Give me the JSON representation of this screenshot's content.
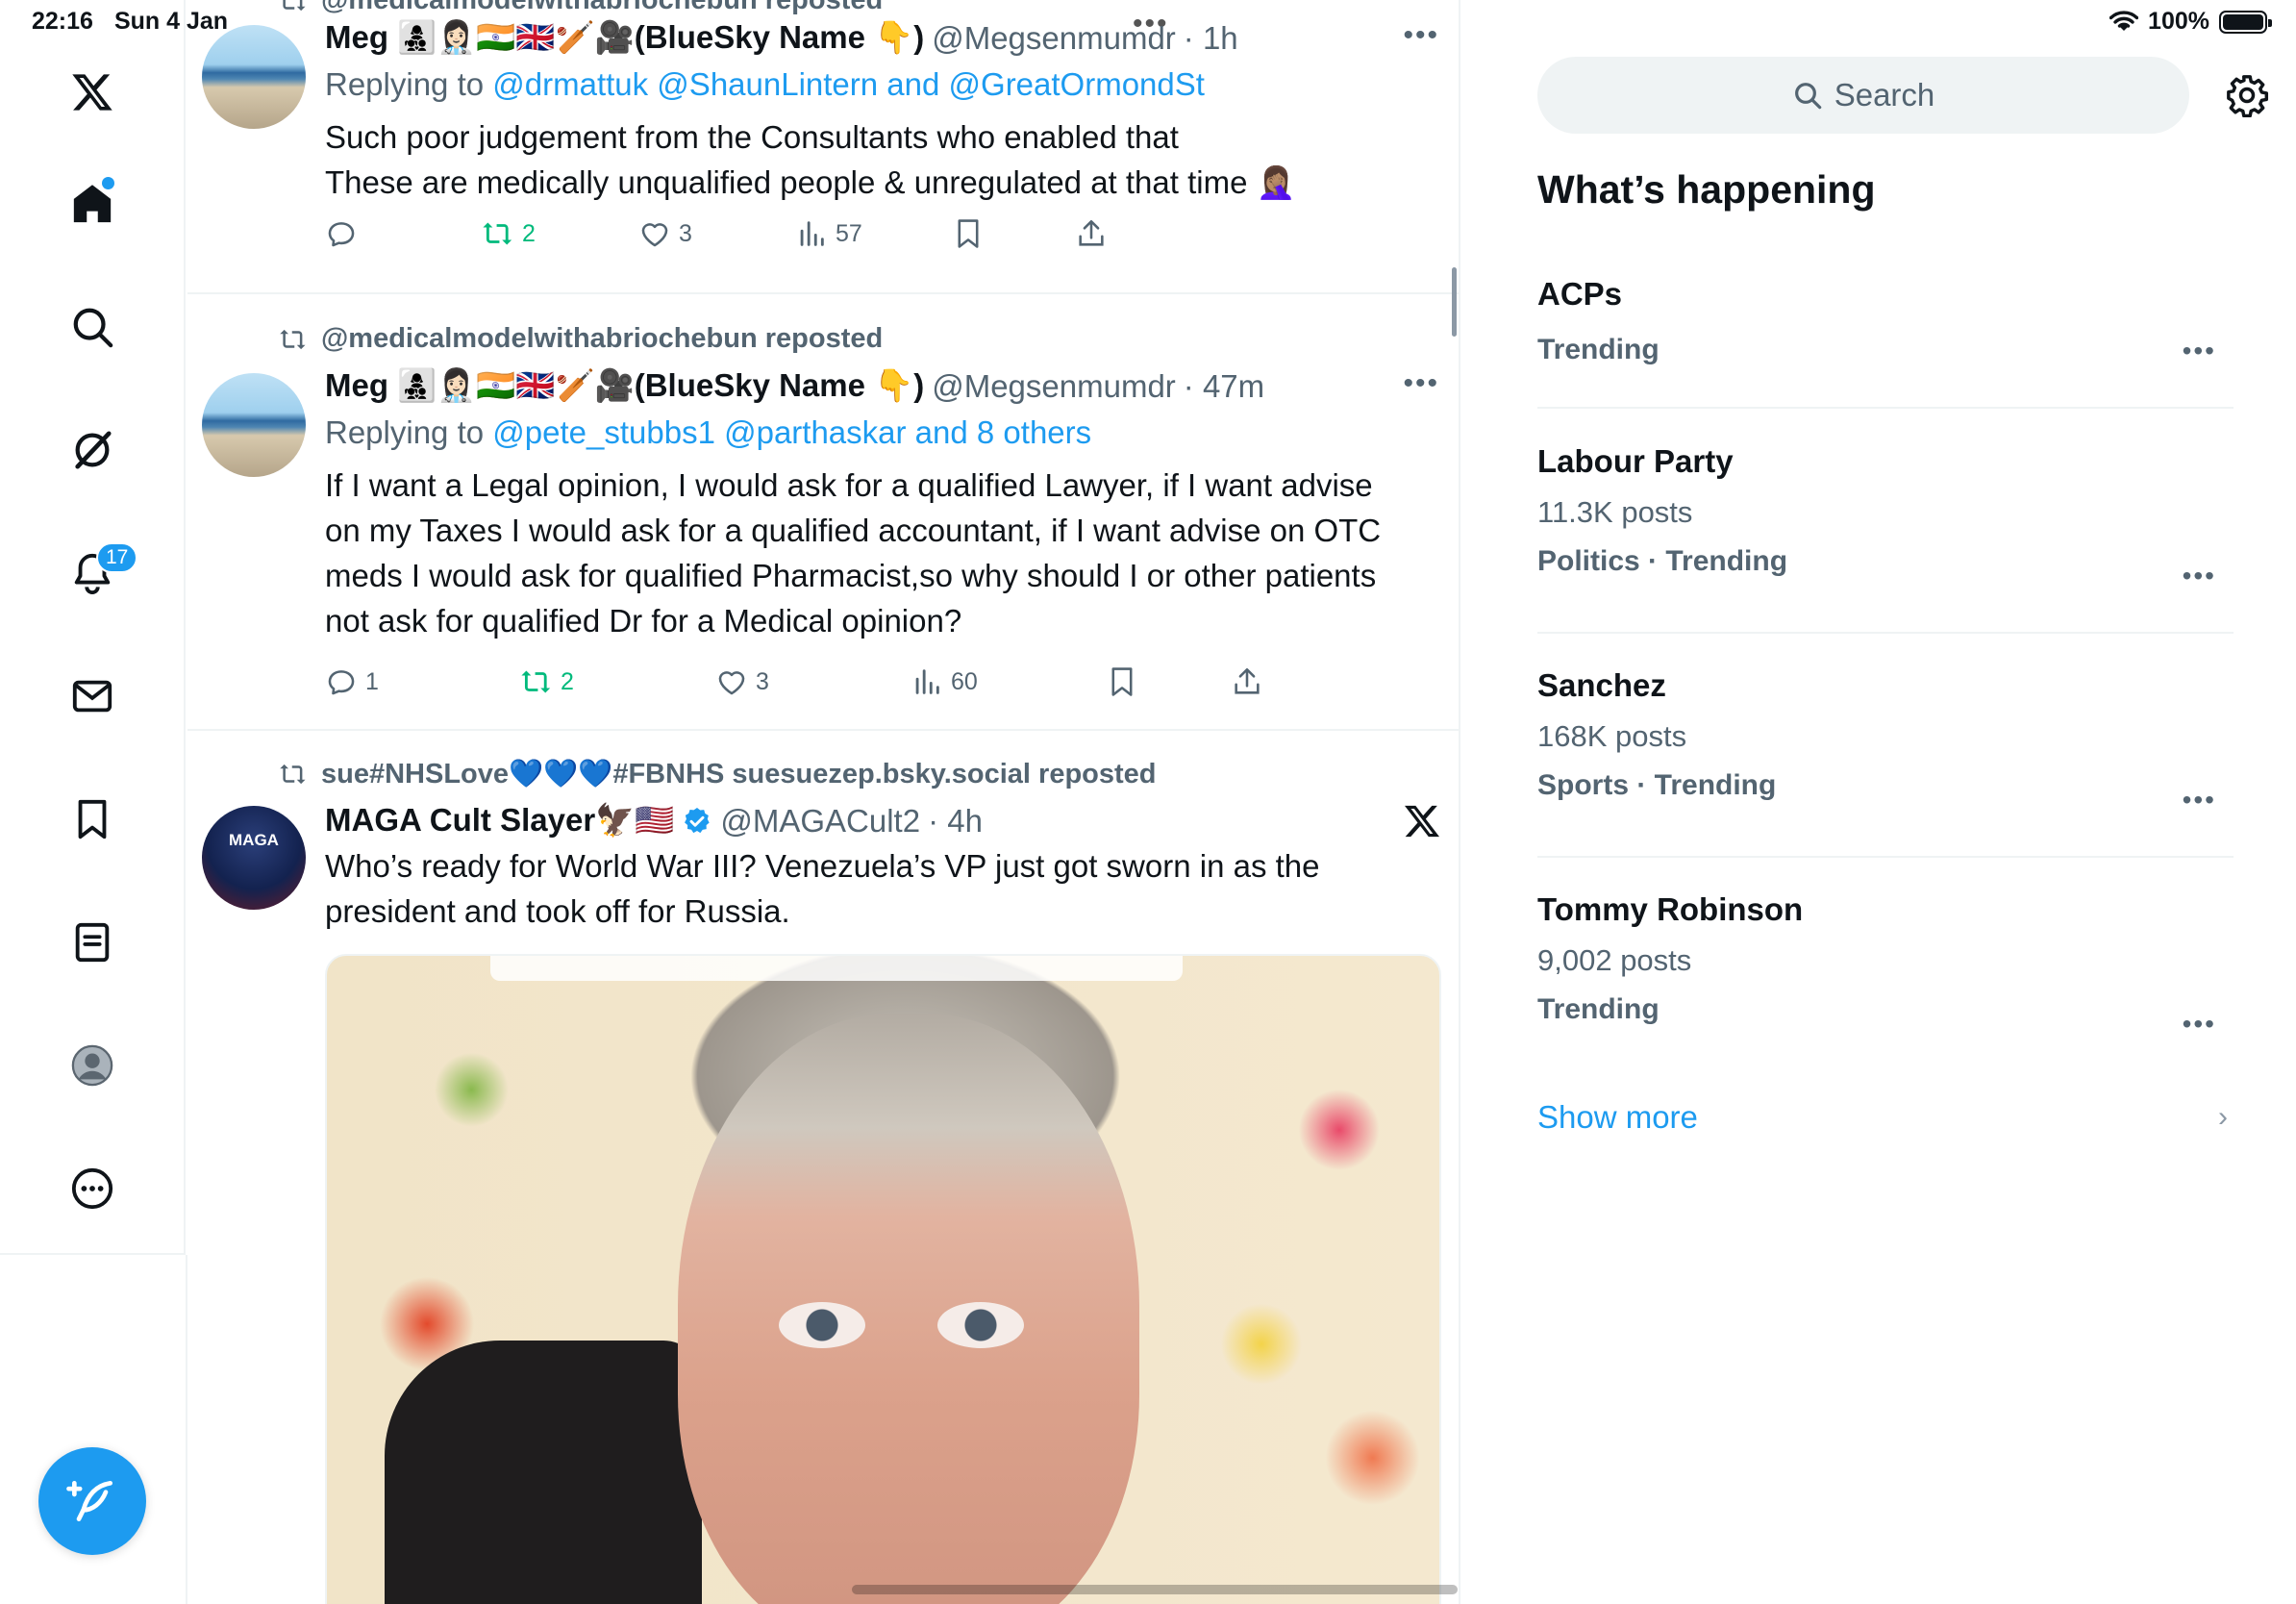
{
  "status": {
    "time": "22:16",
    "date": "Sun 4 Jan",
    "battery": "100%"
  },
  "nav": {
    "notifications_badge": "17"
  },
  "posts": [
    {
      "repost_label": "@medicalmodelwithabriochebun reposted",
      "name": "Meg 👩‍👧‍👦👩🏻‍⚕️🇮🇳🇬🇧🏏🎥(BlueSky Name 👇)",
      "handle": "@Megsenmumdr",
      "time": "· 1h",
      "reply_prefix": "Replying to ",
      "reply_links": "@drmattuk @ShaunLintern and @GreatOrmondSt",
      "text_lines": [
        "Such poor judgement from the Consultants who enabled that",
        "These are medically unqualified people & unregulated at that time 🤦🏽‍♀️"
      ],
      "replies": "",
      "reposts": "2",
      "likes": "3",
      "views": "57"
    },
    {
      "repost_label": "@medicalmodelwithabriochebun reposted",
      "name": "Meg 👩‍👧‍👦👩🏻‍⚕️🇮🇳🇬🇧🏏🎥(BlueSky Name 👇)",
      "handle": "@Megsenmumdr",
      "time": "· 47m",
      "reply_prefix": "Replying to ",
      "reply_links": "@pete_stubbs1 @parthaskar and 8 others",
      "text_lines": [
        "If I want a Legal opinion, I would ask for a qualified Lawyer, if I want advise",
        "on my Taxes I would ask for a qualified accountant, if I want advise on OTC",
        "meds I would ask for qualified Pharmacist,so why should I or other patients",
        "not ask for qualified Dr for a Medical opinion?"
      ],
      "replies": "1",
      "reposts": "2",
      "likes": "3",
      "views": "60"
    },
    {
      "repost_label": "sue#NHSLove💙💙💙#FBNHS suesuezep.bsky.social reposted",
      "name": "MAGA Cult Slayer🦅🇺🇸",
      "handle": "@MAGACult2",
      "time": "· 4h",
      "text_lines": [
        "Who’s ready for World War III? Venezuela’s VP just got sworn in as the",
        "president and took off for Russia."
      ],
      "avatar_text": "MAGA"
    }
  ],
  "right": {
    "search_placeholder": "Search",
    "section_title": "What’s happening",
    "trends": [
      {
        "name": "ACPs",
        "count": "",
        "meta": "Trending"
      },
      {
        "name": "Labour Party",
        "count": "11.3K posts",
        "meta": "Politics · Trending"
      },
      {
        "name": "Sanchez",
        "count": "168K posts",
        "meta": "Sports · Trending"
      },
      {
        "name": "Tommy Robinson",
        "count": "9,002 posts",
        "meta": "Trending"
      }
    ],
    "show_more": "Show more"
  },
  "colors": {
    "accent": "#1d9bf0",
    "repost_green": "#00ba7c",
    "muted": "#536471"
  },
  "icons": [
    "x-logo-icon",
    "home-icon",
    "search-icon",
    "grok-icon",
    "bell-icon",
    "mail-icon",
    "bookmark-icon",
    "lists-icon",
    "profile-icon",
    "more-circle-icon",
    "compose-icon",
    "gear-icon"
  ]
}
